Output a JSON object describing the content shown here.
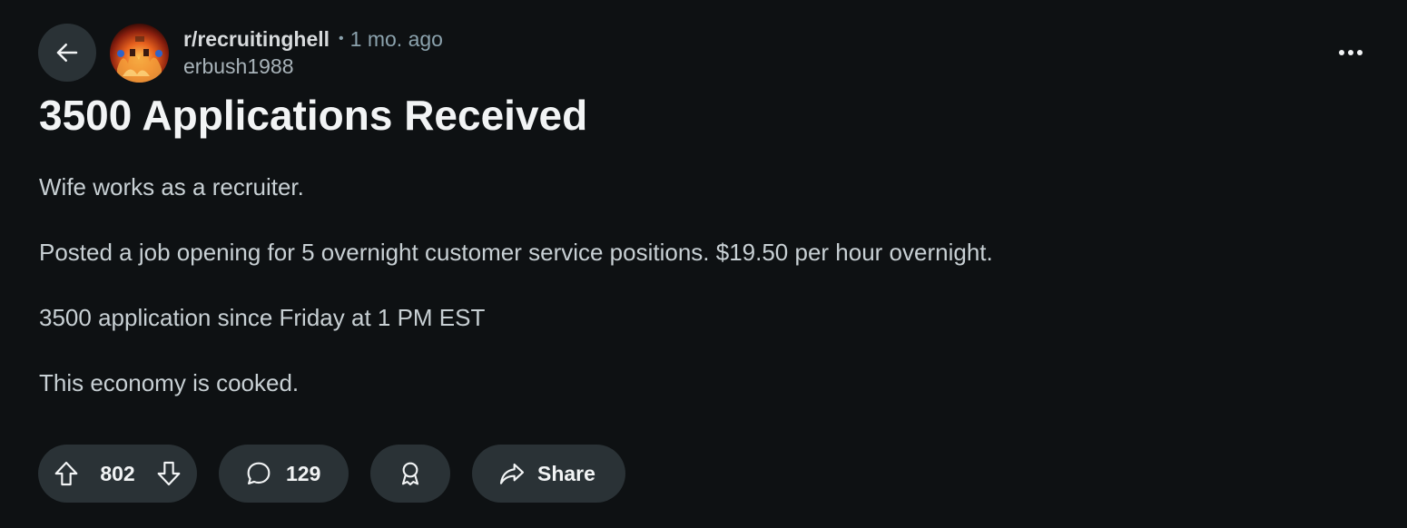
{
  "post": {
    "subreddit": "r/recruitinghell",
    "separator": "•",
    "time_ago": "1 mo. ago",
    "author": "erbush1988",
    "title": "3500 Applications Received",
    "body": [
      "Wife works as a recruiter.",
      "Posted a job opening for 5 overnight customer service positions. $19.50 per hour overnight.",
      "3500 application since Friday at 1 PM EST",
      "This economy is cooked."
    ]
  },
  "actions": {
    "votes": "802",
    "comments": "129",
    "share_label": "Share"
  },
  "icons": {
    "back": "arrow-left-icon",
    "more": "more-horizontal-icon",
    "upvote": "arrow-up-icon",
    "downvote": "arrow-down-icon",
    "comment": "comment-bubble-icon",
    "award": "award-icon",
    "share": "share-arrow-icon"
  },
  "colors": {
    "background": "#0e1113",
    "pill": "#2a3236",
    "text": "#f2f4f5",
    "muted": "#8ba2ad",
    "body_text": "#c8d0d4"
  }
}
